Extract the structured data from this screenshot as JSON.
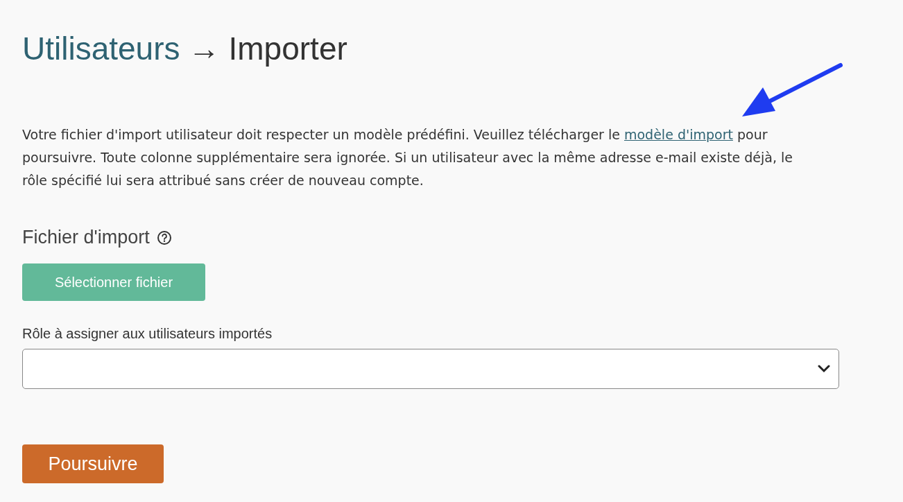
{
  "header": {
    "breadcrumb": "Utilisateurs",
    "separator": "→",
    "current": "Importer"
  },
  "intro": {
    "before": "Votre fichier d'import utilisateur doit respecter un modèle prédéfini. Veuillez télécharger le",
    "link": "modèle d'import",
    "after": "pour poursuivre. Toute colonne supplémentaire sera ignorée. Si un utilisateur avec la même adresse e-mail existe déjà, le rôle spécifié lui sera attribué sans créer de nouveau compte."
  },
  "file_field": {
    "label": "Fichier d'import",
    "button": "Sélectionner fichier"
  },
  "role_field": {
    "label": "Rôle à assigner aux utilisateurs importés"
  },
  "submit": "Poursuivre"
}
